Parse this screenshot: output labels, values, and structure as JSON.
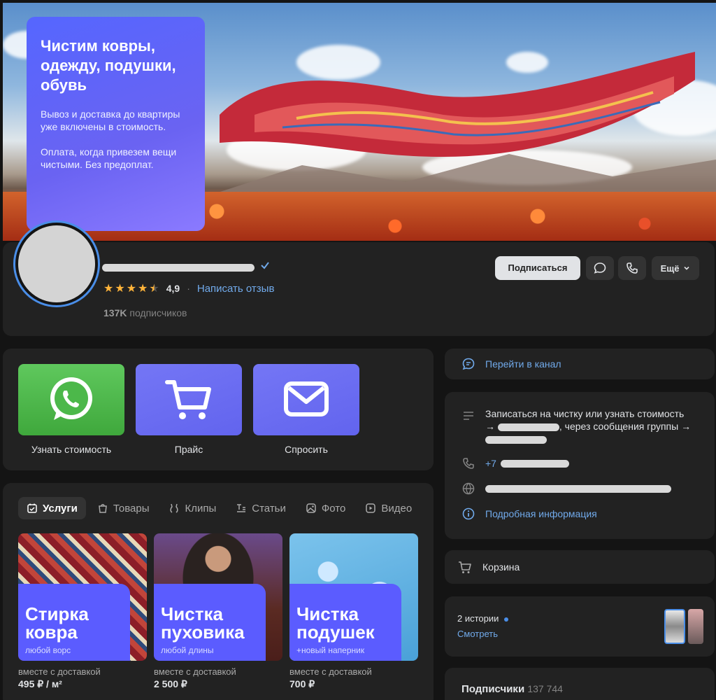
{
  "cover": {
    "title": "Чистим ковры, одежду, подушки, обувь",
    "text1": "Вывоз и доставка до квартиры уже включены в стоимость.",
    "text2": "Оплата, когда привезем вещи чистыми. Без предоплат."
  },
  "profile": {
    "rating": "4,9",
    "review_link": "Написать отзыв",
    "subscribers_count": "137K",
    "subscribers_label": "подписчиков",
    "subscribe_button": "Подписаться",
    "more_button": "Ещё",
    "stars": 4.5
  },
  "actions": [
    {
      "label": "Узнать стоимость",
      "icon": "whatsapp-icon",
      "color": "#4cb84a"
    },
    {
      "label": "Прайс",
      "icon": "cart-icon",
      "color": "#6b6df2"
    },
    {
      "label": "Спросить",
      "icon": "mail-icon",
      "color": "#6b6df2"
    }
  ],
  "tabs": [
    {
      "label": "Услуги",
      "icon": "services-icon"
    },
    {
      "label": "Товары",
      "icon": "bag-icon"
    },
    {
      "label": "Клипы",
      "icon": "clips-icon"
    },
    {
      "label": "Статьи",
      "icon": "articles-icon"
    },
    {
      "label": "Фото",
      "icon": "photo-icon"
    },
    {
      "label": "Видео",
      "icon": "video-icon"
    }
  ],
  "products": [
    {
      "title1": "Стирка",
      "title2": "ковра",
      "subtitle": "любой ворс",
      "caption": "вместе с доставкой",
      "price": "495 ₽ / м²"
    },
    {
      "title1": "Чистка",
      "title2": "пуховика",
      "subtitle": "любой длины",
      "caption": "вместе с доставкой",
      "price": "2 500 ₽"
    },
    {
      "title1": "Чистка",
      "title2": "подушек",
      "subtitle": "+новый наперник",
      "caption": "вместе с доставкой",
      "price": "700 ₽"
    }
  ],
  "sidebar": {
    "channel_link": "Перейти в канал",
    "info_text1": "Записаться на чистку или узнать стоимость",
    "info_arrow": "→",
    "info_text2": ", через сообщения группы →",
    "phone_prefix": "+7",
    "more_info": "Подробная информация",
    "cart": "Корзина",
    "stories_count": "2 истории",
    "stories_watch": "Смотреть",
    "subscribers_title": "Подписчики",
    "subscribers_count": "137 744"
  }
}
